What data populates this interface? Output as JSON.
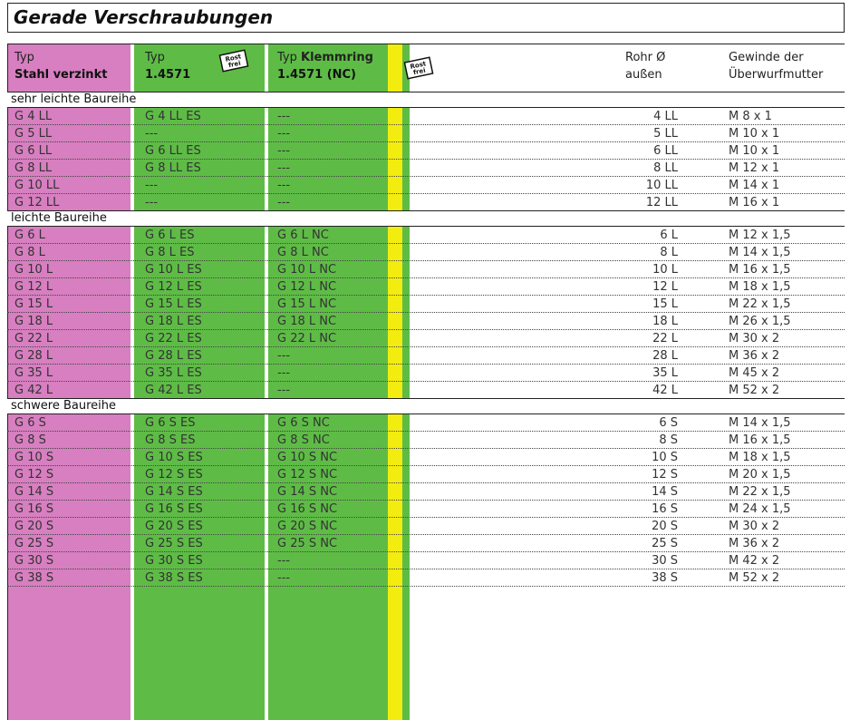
{
  "title": "Gerade Verschraubungen",
  "header": {
    "col1_line1": "Typ",
    "col1_line2": "Stahl verzinkt",
    "col2_line1": "Typ",
    "col2_line2": "1.4571",
    "col3_prefix": "Typ",
    "col3_bold": "Klemmring",
    "col3_line2": "1.4571 (NC)",
    "rohr_line1": "Rohr Ø",
    "rohr_line2": "außen",
    "gew_line1": "Gewinde der",
    "gew_line2": "Überwurfmutter",
    "badge_text1": "Rost",
    "badge_text2": "frei"
  },
  "colors": {
    "pink": "#d77fc0",
    "green": "#5ebc46",
    "yellow": "#f2ec0f"
  },
  "sections": [
    {
      "label": "sehr leichte Baureihe",
      "rows": [
        {
          "typ": "G 4 LL",
          "es": "G 4 LL ES",
          "nc": "---",
          "rohr": "4 LL",
          "gew": "M 8 x 1"
        },
        {
          "typ": "G 5 LL",
          "es": "---",
          "nc": "---",
          "rohr": "5 LL",
          "gew": "M 10 x 1"
        },
        {
          "typ": "G 6 LL",
          "es": "G 6 LL ES",
          "nc": "---",
          "rohr": "6 LL",
          "gew": "M 10 x 1"
        },
        {
          "typ": "G 8 LL",
          "es": "G 8 LL ES",
          "nc": "---",
          "rohr": "8 LL",
          "gew": "M 12 x 1"
        },
        {
          "typ": "G 10 LL",
          "es": "---",
          "nc": "---",
          "rohr": "10 LL",
          "gew": "M 14 x 1"
        },
        {
          "typ": "G 12 LL",
          "es": "---",
          "nc": "---",
          "rohr": "12 LL",
          "gew": "M 16 x 1"
        }
      ]
    },
    {
      "label": "leichte Baureihe",
      "rows": [
        {
          "typ": "G 6 L",
          "es": "G 6 L ES",
          "nc": "G 6 L NC",
          "rohr": "6 L",
          "gew": "M 12 x 1,5"
        },
        {
          "typ": "G 8 L",
          "es": "G 8 L ES",
          "nc": "G 8 L NC",
          "rohr": "8 L",
          "gew": "M 14 x 1,5"
        },
        {
          "typ": "G 10 L",
          "es": "G 10 L ES",
          "nc": "G 10 L NC",
          "rohr": "10 L",
          "gew": "M 16 x 1,5"
        },
        {
          "typ": "G 12 L",
          "es": "G 12 L ES",
          "nc": "G 12 L NC",
          "rohr": "12 L",
          "gew": "M 18 x 1,5"
        },
        {
          "typ": "G 15 L",
          "es": "G 15 L ES",
          "nc": "G 15 L NC",
          "rohr": "15 L",
          "gew": "M 22 x 1,5"
        },
        {
          "typ": "G 18 L",
          "es": "G 18 L ES",
          "nc": "G 18 L NC",
          "rohr": "18 L",
          "gew": "M 26 x 1,5"
        },
        {
          "typ": "G 22 L",
          "es": "G 22 L ES",
          "nc": "G 22 L NC",
          "rohr": "22 L",
          "gew": "M 30 x 2"
        },
        {
          "typ": "G 28 L",
          "es": "G 28 L ES",
          "nc": "---",
          "rohr": "28 L",
          "gew": "M 36 x 2"
        },
        {
          "typ": "G 35 L",
          "es": "G 35 L ES",
          "nc": "---",
          "rohr": "35 L",
          "gew": "M 45 x 2"
        },
        {
          "typ": "G 42 L",
          "es": "G 42 L ES",
          "nc": "---",
          "rohr": "42 L",
          "gew": "M 52 x 2"
        }
      ]
    },
    {
      "label": "schwere Baureihe",
      "rows": [
        {
          "typ": "G 6 S",
          "es": "G 6 S ES",
          "nc": "G 6 S NC",
          "rohr": "6 S",
          "gew": "M 14 x 1,5"
        },
        {
          "typ": "G 8 S",
          "es": "G 8 S ES",
          "nc": "G 8 S NC",
          "rohr": "8 S",
          "gew": "M 16 x 1,5"
        },
        {
          "typ": "G 10 S",
          "es": "G 10 S ES",
          "nc": "G 10 S NC",
          "rohr": "10 S",
          "gew": "M 18 x 1,5"
        },
        {
          "typ": "G 12 S",
          "es": "G 12 S ES",
          "nc": "G 12 S NC",
          "rohr": "12 S",
          "gew": "M 20 x 1,5"
        },
        {
          "typ": "G 14 S",
          "es": "G 14 S ES",
          "nc": "G 14 S NC",
          "rohr": "14 S",
          "gew": "M 22 x 1,5"
        },
        {
          "typ": "G 16 S",
          "es": "G 16 S ES",
          "nc": "G 16 S NC",
          "rohr": "16 S",
          "gew": "M 24 x 1,5"
        },
        {
          "typ": "G 20 S",
          "es": "G 20 S ES",
          "nc": "G 20 S NC",
          "rohr": "20 S",
          "gew": "M 30 x 2"
        },
        {
          "typ": "G 25 S",
          "es": "G 25 S ES",
          "nc": "G 25 S NC",
          "rohr": "25 S",
          "gew": "M 36 x 2"
        },
        {
          "typ": "G 30 S",
          "es": "G 30 S ES",
          "nc": "---",
          "rohr": "30 S",
          "gew": "M 42 x 2"
        },
        {
          "typ": "G 38 S",
          "es": "G 38 S ES",
          "nc": "---",
          "rohr": "38 S",
          "gew": "M 52 x 2"
        }
      ]
    }
  ]
}
